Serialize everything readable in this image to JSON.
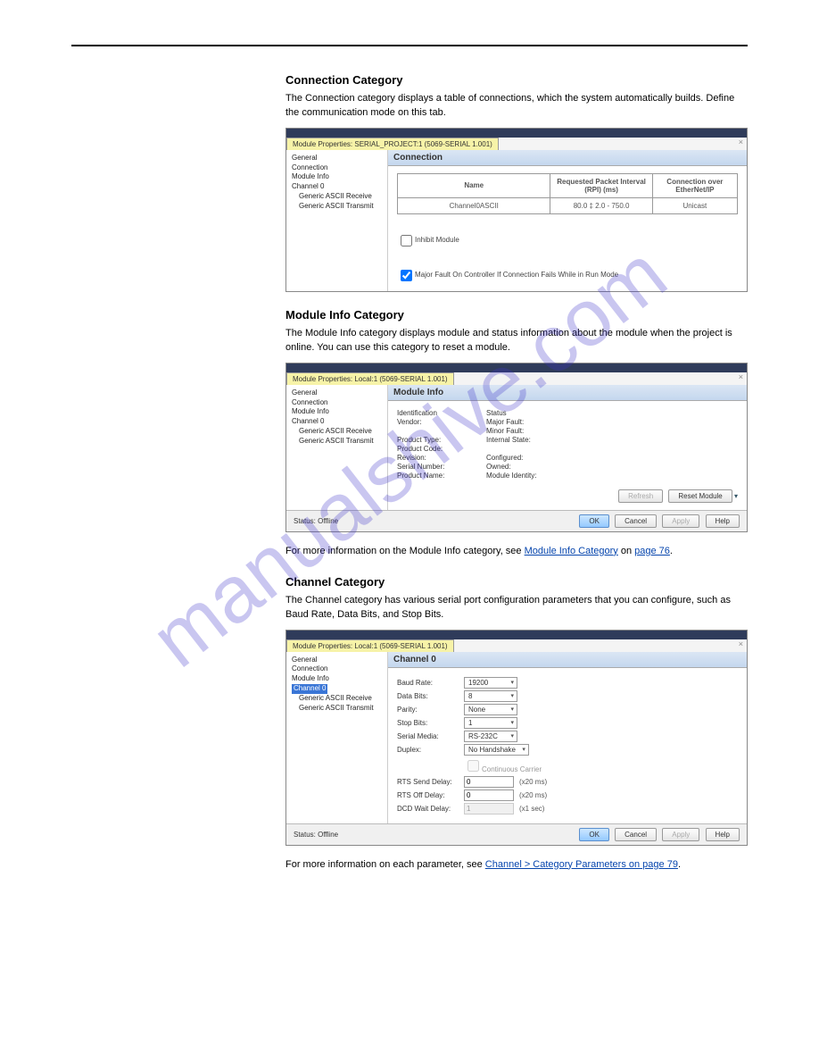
{
  "watermark": "manualshive.com",
  "sections": {
    "conn_heading": "Connection Category",
    "conn_text": "The Connection category displays a table of connections, which the system automatically builds. Define the communication mode on this tab.",
    "modinfo_heading": "Module Info Category",
    "modinfo_text1": "The Module Info category displays module and status information about the module when the project is online. You can use this category to reset a module.",
    "modinfo_text2_pre": "For more information on the Module Info category, see ",
    "modinfo_link": "Module Info Category",
    "modinfo_text2_mid": " on ",
    "modinfo_page": "page 76",
    "modinfo_text2_post": ".",
    "chan_heading": "Channel Category",
    "chan_text": "The Channel category has various serial port configuration parameters that you can configure, such as Baud Rate, Data Bits, and Stop Bits.",
    "chan_note": "For more information on each parameter, see ",
    "chan_link": "Channel > Category Parameters on page 79",
    "chan_note_post": "."
  },
  "shot1": {
    "tab": "Module Properties: SERIAL_PROJECT:1 (5069-SERIAL 1.001)",
    "tree": [
      "General",
      "Connection",
      "Module Info",
      "Channel 0",
      "Generic ASCII Receive",
      "Generic ASCII Transmit"
    ],
    "pane_title": "Connection",
    "th_name": "Name",
    "th_rpi": "Requested Packet Interval (RPI) (ms)",
    "th_conn": "Connection over EtherNet/IP",
    "row_name": "Channel0ASCII",
    "row_rpi": "80.0 ‡ 2.0 - 750.0",
    "row_conn": "Unicast",
    "inhibit": "Inhibit Module",
    "major_fault": "Major Fault On Controller If Connection Fails While in Run Mode"
  },
  "shot2": {
    "tab": "Module Properties: Local:1 (5069-SERIAL 1.001)",
    "tree": [
      "General",
      "Connection",
      "Module Info",
      "Channel 0",
      "Generic ASCII Receive",
      "Generic ASCII Transmit"
    ],
    "pane_title": "Module Info",
    "left_labels": [
      "Identification",
      "Vendor:",
      "",
      "Product Type:",
      "Product Code:",
      "Revision:",
      "Serial Number:",
      "Product Name:"
    ],
    "right_labels": [
      "Status",
      "Major Fault:",
      "Minor Fault:",
      "Internal State:",
      "",
      "Configured:",
      "Owned:",
      "Module Identity:"
    ],
    "refresh": "Refresh",
    "reset": "Reset Module",
    "status": "Status: Offline",
    "ok": "OK",
    "cancel": "Cancel",
    "apply": "Apply",
    "help": "Help"
  },
  "shot3": {
    "tab": "Module Properties: Local:1 (5069-SERIAL 1.001)",
    "tree": [
      "General",
      "Connection",
      "Module Info",
      "Channel 0",
      "Generic ASCII Receive",
      "Generic ASCII Transmit"
    ],
    "selected": "Channel 0",
    "pane_title": "Channel 0",
    "fields": [
      {
        "label": "Baud Rate:",
        "value": "19200",
        "type": "drop"
      },
      {
        "label": "Data Bits:",
        "value": "8",
        "type": "drop"
      },
      {
        "label": "Parity:",
        "value": "None",
        "type": "drop"
      },
      {
        "label": "Stop Bits:",
        "value": "1",
        "type": "drop"
      },
      {
        "label": "Serial Media:",
        "value": "RS-232C",
        "type": "drop"
      },
      {
        "label": "Duplex:",
        "value": "No Handshake",
        "type": "drop"
      }
    ],
    "cont_carrier": "Continuous Carrier",
    "rts_send": {
      "label": "RTS Send Delay:",
      "value": "0",
      "unit": "(x20 ms)"
    },
    "rts_off": {
      "label": "RTS Off Delay:",
      "value": "0",
      "unit": "(x20 ms)"
    },
    "dcd": {
      "label": "DCD Wait Delay:",
      "value": "1",
      "unit": "(x1 sec)"
    },
    "status": "Status: Offline",
    "ok": "OK",
    "cancel": "Cancel",
    "apply": "Apply",
    "help": "Help"
  }
}
